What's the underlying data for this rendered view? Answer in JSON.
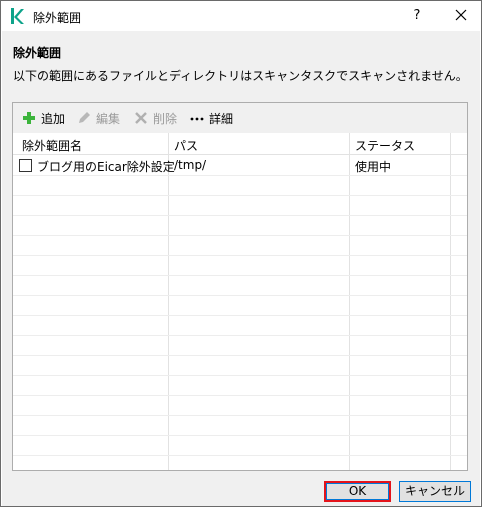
{
  "window": {
    "title": "除外範囲"
  },
  "header": {
    "heading": "除外範囲",
    "description": "以下の範囲にあるファイルとディレクトリはスキャンタスクでスキャンされません。"
  },
  "toolbar": {
    "add_label": "追加",
    "edit_label": "編集",
    "delete_label": "削除",
    "details_label": "詳細"
  },
  "table": {
    "columns": [
      "除外範囲名",
      "パス",
      "ステータス"
    ],
    "rows": [
      {
        "name": "ブログ用のEicar除外設定",
        "path": "/tmp/",
        "status": "使用中",
        "checked": false
      }
    ]
  },
  "footer": {
    "ok_label": "OK",
    "cancel_label": "キャンセル"
  },
  "colors": {
    "add_icon": "#3cb43c",
    "highlight_border": "#e4141b",
    "focus_border": "#0078d7",
    "brand": "#0da38a"
  }
}
